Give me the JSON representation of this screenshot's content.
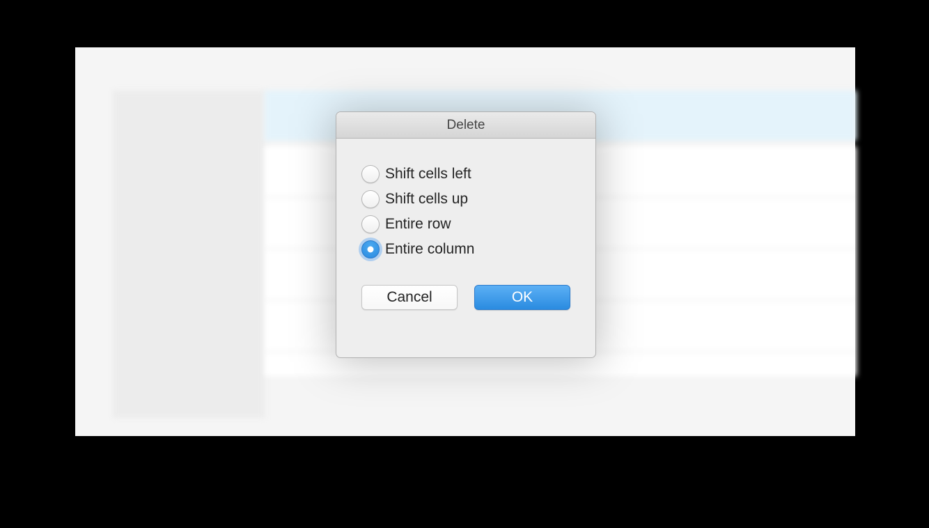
{
  "dialog": {
    "title": "Delete",
    "options": [
      {
        "label": "Shift cells left",
        "selected": false
      },
      {
        "label": "Shift cells up",
        "selected": false
      },
      {
        "label": "Entire row",
        "selected": false
      },
      {
        "label": "Entire column",
        "selected": true
      }
    ],
    "buttons": {
      "cancel": "Cancel",
      "ok": "OK"
    }
  }
}
